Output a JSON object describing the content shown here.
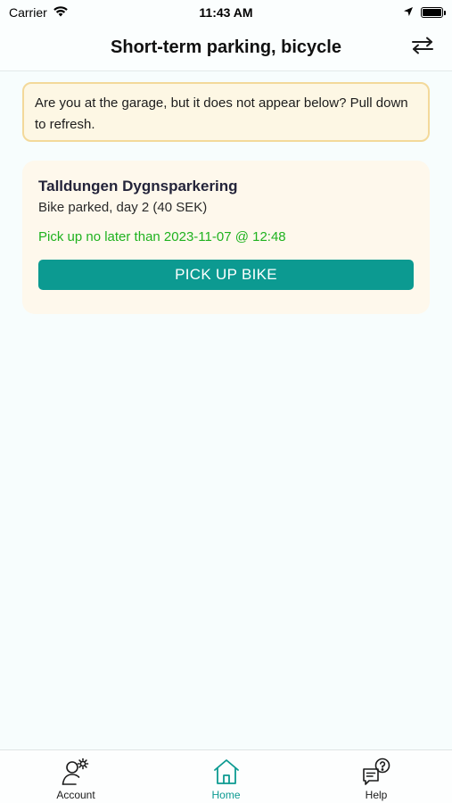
{
  "status_bar": {
    "carrier": "Carrier",
    "time": "11:43 AM"
  },
  "header": {
    "title": "Short-term parking, bicycle",
    "swap_icon": "swap-arrows-icon"
  },
  "banner": {
    "text": "Are you at the garage, but it does not appear below? Pull down to refresh."
  },
  "parking": {
    "name": "Talldungen Dygnsparkering",
    "status": "Bike parked, day 2 (40 SEK)",
    "pickup_deadline": "Pick up no later than 2023-11-07 @ 12:48",
    "button_label": "PICK UP BIKE"
  },
  "tabs": [
    {
      "label": "Account",
      "icon": "account-settings-icon",
      "active": false
    },
    {
      "label": "Home",
      "icon": "home-icon",
      "active": true
    },
    {
      "label": "Help",
      "icon": "help-icon",
      "active": false
    }
  ],
  "colors": {
    "accent": "#0c9a91",
    "pickup_text": "#1fb21f",
    "banner_bg": "#fdf7e4",
    "banner_border": "#f3d99a",
    "card_bg": "#fef8ec"
  }
}
